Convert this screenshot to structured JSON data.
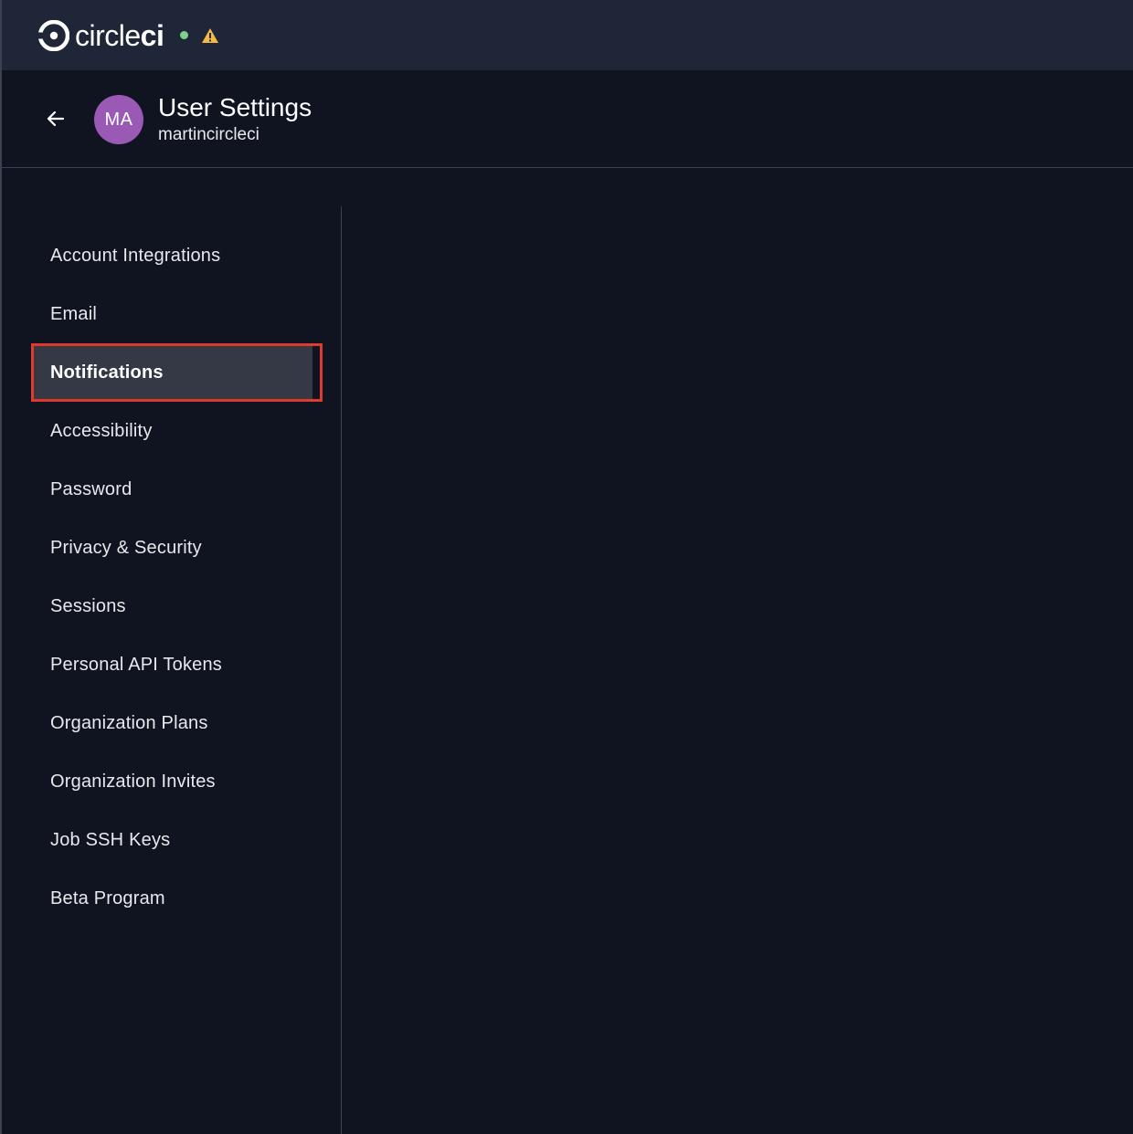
{
  "brand": {
    "logo_icon": "circleci-logo-icon",
    "name_light": "circle",
    "name_bold": "ci",
    "status_color": "#7fce8b",
    "warning_color": "#f5b942"
  },
  "header": {
    "back_icon": "arrow-left-icon",
    "avatar_initials": "MA",
    "avatar_color": "#9b59b6",
    "title": "User Settings",
    "username": "martincircleci"
  },
  "nav": {
    "items": [
      {
        "label": "Account Integrations"
      },
      {
        "label": "Email"
      },
      {
        "label": "Notifications",
        "active": true
      },
      {
        "label": "Accessibility"
      },
      {
        "label": "Password"
      },
      {
        "label": "Privacy & Security"
      },
      {
        "label": "Sessions"
      },
      {
        "label": "Personal API Tokens"
      },
      {
        "label": "Organization Plans"
      },
      {
        "label": "Organization Invites"
      },
      {
        "label": "Job SSH Keys"
      },
      {
        "label": "Beta Program"
      }
    ],
    "highlight_color": "#e03a2e"
  }
}
